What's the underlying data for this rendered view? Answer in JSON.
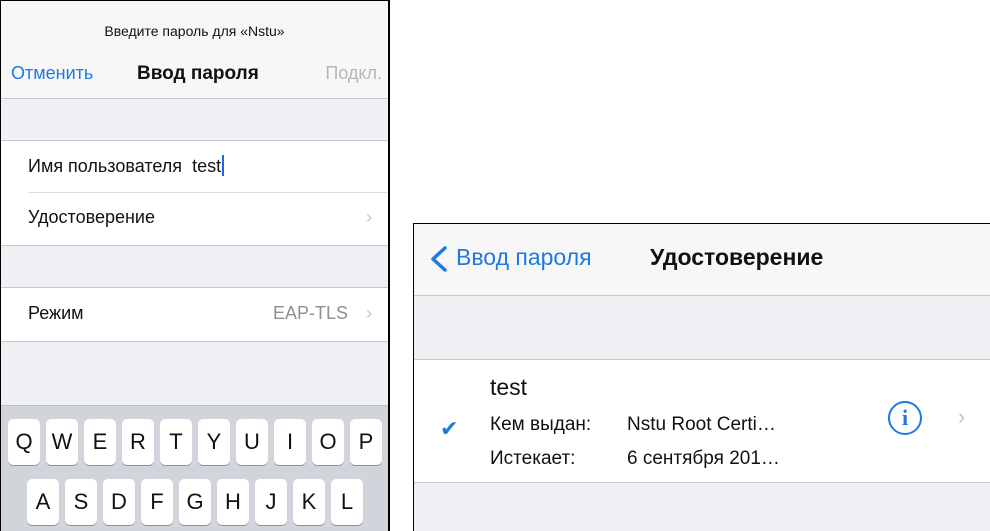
{
  "left": {
    "prompt": "Введите пароль для «Nstu»",
    "cancel": "Отменить",
    "title": "Ввод пароля",
    "connect": "Подкл.",
    "username_label": "Имя пользователя",
    "username_value": "test",
    "identity_label": "Удостоверение",
    "mode_label": "Режим",
    "mode_value": "EAP-TLS",
    "chevron": "›",
    "keyboard_row1": [
      "Q",
      "W",
      "E",
      "R",
      "T",
      "Y",
      "U",
      "I",
      "O",
      "P"
    ],
    "keyboard_row2": [
      "A",
      "S",
      "D",
      "F",
      "G",
      "H",
      "J",
      "K",
      "L"
    ]
  },
  "right": {
    "back": "Ввод пароля",
    "title": "Удостоверение",
    "cert_name": "test",
    "issued_by_label": "Кем выдан:",
    "issued_by_value": "Nstu Root Certi…",
    "expires_label": "Истекает:",
    "expires_value": "6 сентября 201…",
    "check": "✔",
    "info": "i",
    "chevron": "›"
  },
  "colors": {
    "accent": "#1f7ae0",
    "disabled": "#b7b7bb",
    "group_bg": "#efeff4"
  }
}
